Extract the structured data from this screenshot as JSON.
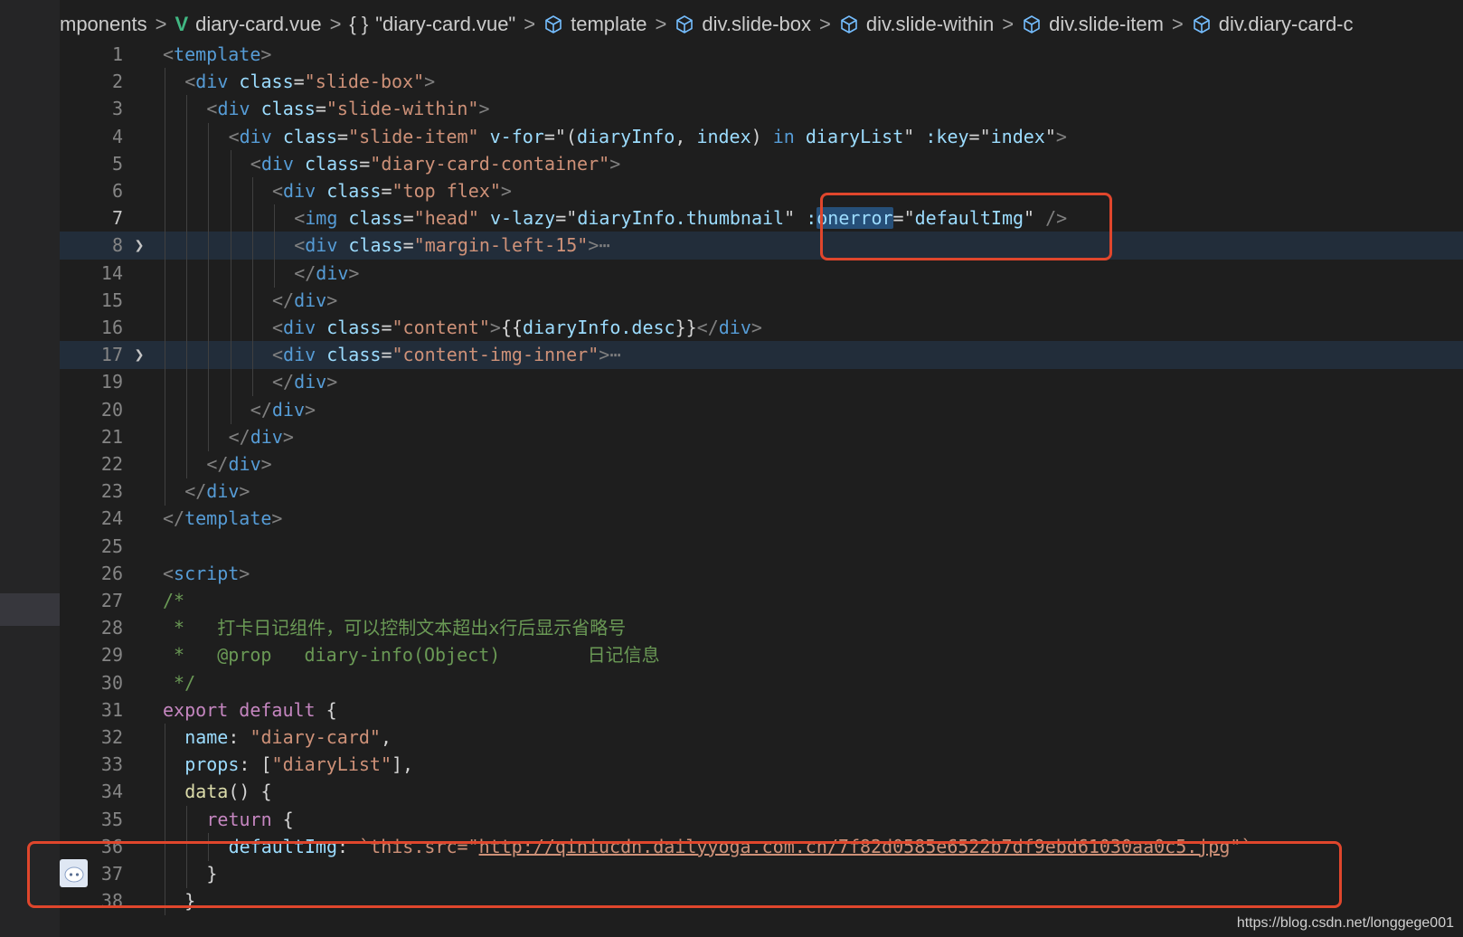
{
  "breadcrumb": {
    "items": [
      {
        "icon": "none",
        "label": "mponents"
      },
      {
        "icon": "vue-icon",
        "label": "diary-card.vue"
      },
      {
        "icon": "braces-icon",
        "label": "\"diary-card.vue\""
      },
      {
        "icon": "cube-icon",
        "label": "template"
      },
      {
        "icon": "cube-icon",
        "label": "div.slide-box"
      },
      {
        "icon": "cube-icon",
        "label": "div.slide-within"
      },
      {
        "icon": "cube-icon",
        "label": "div.slide-item"
      },
      {
        "icon": "cube-icon",
        "label": "div.diary-card-c"
      }
    ],
    "separator": ">"
  },
  "colors": {
    "editor_bg": "#1e1e1e",
    "highlight_box": "#e0462c",
    "folded_line_bg": "#222d3a",
    "selection": "#264f78"
  },
  "editor": {
    "lines": [
      {
        "num": "1",
        "indent": 0,
        "tokens": [
          [
            "t-tag",
            "<"
          ],
          [
            "t-name",
            "template"
          ],
          [
            "t-tag",
            ">"
          ]
        ]
      },
      {
        "num": "2",
        "indent": 1,
        "tokens": [
          [
            "t-tag",
            "<"
          ],
          [
            "t-name",
            "div"
          ],
          [
            "t-punc",
            " "
          ],
          [
            "t-attr",
            "class"
          ],
          [
            "t-punc",
            "="
          ],
          [
            "t-str",
            "\"slide-box\""
          ],
          [
            "t-tag",
            ">"
          ]
        ]
      },
      {
        "num": "3",
        "indent": 2,
        "tokens": [
          [
            "t-tag",
            "<"
          ],
          [
            "t-name",
            "div"
          ],
          [
            "t-punc",
            " "
          ],
          [
            "t-attr",
            "class"
          ],
          [
            "t-punc",
            "="
          ],
          [
            "t-str",
            "\"slide-within\""
          ],
          [
            "t-tag",
            ">"
          ]
        ]
      },
      {
        "num": "4",
        "indent": 3,
        "tokens": [
          [
            "t-tag",
            "<"
          ],
          [
            "t-name",
            "div"
          ],
          [
            "t-punc",
            " "
          ],
          [
            "t-attr",
            "class"
          ],
          [
            "t-punc",
            "="
          ],
          [
            "t-str",
            "\"slide-item\""
          ],
          [
            "t-punc",
            " "
          ],
          [
            "t-attr",
            "v-for"
          ],
          [
            "t-punc",
            "=\"("
          ],
          [
            "t-attr",
            "diaryInfo"
          ],
          [
            "t-punc",
            ", "
          ],
          [
            "t-attr",
            "index"
          ],
          [
            "t-punc",
            ") "
          ],
          [
            "t-name",
            "in"
          ],
          [
            "t-punc",
            " "
          ],
          [
            "t-attr",
            "diaryList"
          ],
          [
            "t-punc",
            "\" "
          ],
          [
            "t-attr",
            ":key"
          ],
          [
            "t-punc",
            "=\""
          ],
          [
            "t-attr",
            "index"
          ],
          [
            "t-punc",
            "\""
          ],
          [
            "t-tag",
            ">"
          ]
        ]
      },
      {
        "num": "5",
        "indent": 4,
        "tokens": [
          [
            "t-tag",
            "<"
          ],
          [
            "t-name",
            "div"
          ],
          [
            "t-punc",
            " "
          ],
          [
            "t-attr",
            "class"
          ],
          [
            "t-punc",
            "="
          ],
          [
            "t-str",
            "\"diary-card-container\""
          ],
          [
            "t-tag",
            ">"
          ]
        ]
      },
      {
        "num": "6",
        "indent": 5,
        "tokens": [
          [
            "t-tag",
            "<"
          ],
          [
            "t-name",
            "div"
          ],
          [
            "t-punc",
            " "
          ],
          [
            "t-attr",
            "class"
          ],
          [
            "t-punc",
            "="
          ],
          [
            "t-str",
            "\"top flex\""
          ],
          [
            "t-tag",
            ">"
          ]
        ]
      },
      {
        "num": "7",
        "indent": 6,
        "current": true,
        "tokens": [
          [
            "t-tag",
            "<"
          ],
          [
            "t-name",
            "img"
          ],
          [
            "t-punc",
            " "
          ],
          [
            "t-attr",
            "class"
          ],
          [
            "t-punc",
            "="
          ],
          [
            "t-str",
            "\"head\""
          ],
          [
            "t-punc",
            " "
          ],
          [
            "t-attr",
            "v-lazy"
          ],
          [
            "t-punc",
            "=\""
          ],
          [
            "t-attr",
            "diaryInfo.thumbnail"
          ],
          [
            "t-punc",
            "\" "
          ],
          [
            "t-attr",
            ":"
          ],
          [
            "t-sel",
            "onerror"
          ],
          [
            "t-punc",
            "=\""
          ],
          [
            "t-attr",
            "defaultImg"
          ],
          [
            "t-punc",
            "\" "
          ],
          [
            "t-tag",
            "/>"
          ]
        ]
      },
      {
        "num": "8",
        "indent": 6,
        "folded": true,
        "tokens": [
          [
            "t-tag",
            "<"
          ],
          [
            "t-name",
            "div"
          ],
          [
            "t-punc",
            " "
          ],
          [
            "t-attr",
            "class"
          ],
          [
            "t-punc",
            "="
          ],
          [
            "t-str",
            "\"margin-left-15\""
          ],
          [
            "t-tag",
            ">"
          ],
          [
            "t-fold",
            "⋯"
          ]
        ]
      },
      {
        "num": "14",
        "indent": 6,
        "tokens": [
          [
            "t-tag",
            "</"
          ],
          [
            "t-name",
            "div"
          ],
          [
            "t-tag",
            ">"
          ]
        ]
      },
      {
        "num": "15",
        "indent": 5,
        "tokens": [
          [
            "t-tag",
            "</"
          ],
          [
            "t-name",
            "div"
          ],
          [
            "t-tag",
            ">"
          ]
        ]
      },
      {
        "num": "16",
        "indent": 5,
        "tokens": [
          [
            "t-tag",
            "<"
          ],
          [
            "t-name",
            "div"
          ],
          [
            "t-punc",
            " "
          ],
          [
            "t-attr",
            "class"
          ],
          [
            "t-punc",
            "="
          ],
          [
            "t-str",
            "\"content\""
          ],
          [
            "t-tag",
            ">"
          ],
          [
            "t-punc",
            "{{"
          ],
          [
            "t-attr",
            "diaryInfo.desc"
          ],
          [
            "t-punc",
            "}}"
          ],
          [
            "t-tag",
            "</"
          ],
          [
            "t-name",
            "div"
          ],
          [
            "t-tag",
            ">"
          ]
        ]
      },
      {
        "num": "17",
        "indent": 5,
        "folded": true,
        "tokens": [
          [
            "t-tag",
            "<"
          ],
          [
            "t-name",
            "div"
          ],
          [
            "t-punc",
            " "
          ],
          [
            "t-attr",
            "class"
          ],
          [
            "t-punc",
            "="
          ],
          [
            "t-str",
            "\"content-img-inner\""
          ],
          [
            "t-tag",
            ">"
          ],
          [
            "t-fold",
            "⋯"
          ]
        ]
      },
      {
        "num": "19",
        "indent": 5,
        "tokens": [
          [
            "t-tag",
            "</"
          ],
          [
            "t-name",
            "div"
          ],
          [
            "t-tag",
            ">"
          ]
        ]
      },
      {
        "num": "20",
        "indent": 4,
        "tokens": [
          [
            "t-tag",
            "</"
          ],
          [
            "t-name",
            "div"
          ],
          [
            "t-tag",
            ">"
          ]
        ]
      },
      {
        "num": "21",
        "indent": 3,
        "tokens": [
          [
            "t-tag",
            "</"
          ],
          [
            "t-name",
            "div"
          ],
          [
            "t-tag",
            ">"
          ]
        ]
      },
      {
        "num": "22",
        "indent": 2,
        "tokens": [
          [
            "t-tag",
            "</"
          ],
          [
            "t-name",
            "div"
          ],
          [
            "t-tag",
            ">"
          ]
        ]
      },
      {
        "num": "23",
        "indent": 1,
        "tokens": [
          [
            "t-tag",
            "</"
          ],
          [
            "t-name",
            "div"
          ],
          [
            "t-tag",
            ">"
          ]
        ]
      },
      {
        "num": "24",
        "indent": 0,
        "tokens": [
          [
            "t-tag",
            "</"
          ],
          [
            "t-name",
            "template"
          ],
          [
            "t-tag",
            ">"
          ]
        ]
      },
      {
        "num": "25",
        "indent": 0,
        "tokens": []
      },
      {
        "num": "26",
        "indent": 0,
        "tokens": [
          [
            "t-tag",
            "<"
          ],
          [
            "t-name",
            "script"
          ],
          [
            "t-tag",
            ">"
          ]
        ]
      },
      {
        "num": "27",
        "indent": 0,
        "tokens": [
          [
            "t-comment",
            "/*"
          ]
        ]
      },
      {
        "num": "28",
        "indent": 0,
        "tokens": [
          [
            "t-comment",
            " *   打卡日记组件，可以控制文本超出x行后显示省略号"
          ]
        ]
      },
      {
        "num": "29",
        "indent": 0,
        "tokens": [
          [
            "t-comment",
            " *   @prop   diary-info(Object)        日记信息"
          ]
        ]
      },
      {
        "num": "30",
        "indent": 0,
        "tokens": [
          [
            "t-comment",
            " */"
          ]
        ]
      },
      {
        "num": "31",
        "indent": 0,
        "tokens": [
          [
            "t-kw",
            "export"
          ],
          [
            "t-punc",
            " "
          ],
          [
            "t-kw",
            "default"
          ],
          [
            "t-punc",
            " {"
          ]
        ]
      },
      {
        "num": "32",
        "indent": 1,
        "tokens": [
          [
            "t-attr",
            "name"
          ],
          [
            "t-punc",
            ": "
          ],
          [
            "t-str",
            "\"diary-card\""
          ],
          [
            "t-punc",
            ","
          ]
        ]
      },
      {
        "num": "33",
        "indent": 1,
        "tokens": [
          [
            "t-attr",
            "props"
          ],
          [
            "t-punc",
            ": ["
          ],
          [
            "t-str",
            "\"diaryList\""
          ],
          [
            "t-punc",
            "],"
          ]
        ]
      },
      {
        "num": "34",
        "indent": 1,
        "tokens": [
          [
            "t-fn",
            "data"
          ],
          [
            "t-punc",
            "() {"
          ]
        ]
      },
      {
        "num": "35",
        "indent": 2,
        "tokens": [
          [
            "t-kw",
            "return"
          ],
          [
            "t-punc",
            " {"
          ]
        ]
      },
      {
        "num": "36",
        "indent": 3,
        "tokens": [
          [
            "t-attr",
            "defaultImg"
          ],
          [
            "t-punc",
            ": "
          ],
          [
            "t-str",
            "`this.src=\""
          ],
          [
            "t-link",
            "http://qiniucdn.dailyyoga.com.cn/7f82d0585e6522b7df9ebd61030aa0c5.jpg"
          ],
          [
            "t-str",
            "\"`"
          ]
        ]
      },
      {
        "num": "37",
        "indent": 2,
        "tokens": [
          [
            "t-punc",
            "}"
          ]
        ]
      },
      {
        "num": "38",
        "indent": 1,
        "tokens": [
          [
            "t-punc",
            "}"
          ]
        ]
      }
    ]
  },
  "watermark": "https://blog.csdn.net/longgege001"
}
